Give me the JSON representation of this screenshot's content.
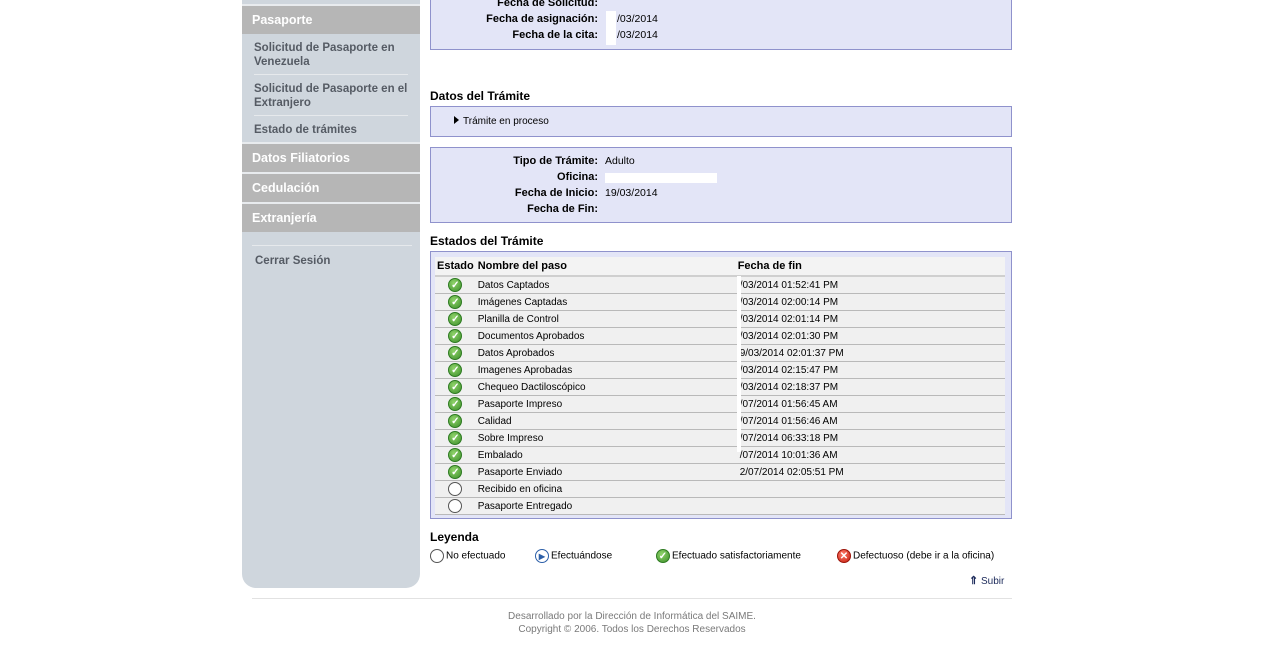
{
  "sidebar": {
    "sections": [
      "Pasaporte",
      "Datos Filiatorios",
      "Cedulación",
      "Extranjería"
    ],
    "pasaporte_items": [
      "Solicitud de Pasaporte en Venezuela",
      "Solicitud de Pasaporte en el Extranjero",
      "Estado de trámites"
    ],
    "logout": "Cerrar Sesión"
  },
  "top_box": {
    "rows": [
      {
        "label": "Fecha de Solicitud:",
        "value": ""
      },
      {
        "label": "Fecha de asignación:",
        "value": "/03/2014"
      },
      {
        "label": "Fecha de la cita:",
        "value": "/03/2014"
      }
    ]
  },
  "tramite": {
    "heading": "Datos del Trámite",
    "toggle_label": "Trámite en proceso",
    "rows": [
      {
        "label": "Tipo de Trámite:",
        "value": "Adulto"
      },
      {
        "label": "Oficina:",
        "value": ""
      },
      {
        "label": "Fecha de Inicio:",
        "value": "19/03/2014"
      },
      {
        "label": "Fecha de Fin:",
        "value": ""
      }
    ]
  },
  "estados": {
    "heading": "Estados del Trámite",
    "columns": [
      "Estado",
      "Nombre del paso",
      "Fecha de fin"
    ],
    "rows": [
      {
        "status": "ok",
        "step": "Datos Captados",
        "date": "/03/2014 01:52:41 PM"
      },
      {
        "status": "ok",
        "step": "Imágenes Captadas",
        "date": "/03/2014 02:00:14 PM"
      },
      {
        "status": "ok",
        "step": "Planilla de Control",
        "date": "/03/2014 02:01:14 PM"
      },
      {
        "status": "ok",
        "step": "Documentos Aprobados",
        "date": "/03/2014 02:01:30 PM"
      },
      {
        "status": "ok",
        "step": "Datos Aprobados",
        "date": "9/03/2014 02:01:37 PM"
      },
      {
        "status": "ok",
        "step": "Imagenes Aprobadas",
        "date": "/03/2014 02:15:47 PM"
      },
      {
        "status": "ok",
        "step": "Chequeo Dactiloscópico",
        "date": "/03/2014 02:18:37 PM"
      },
      {
        "status": "ok",
        "step": "Pasaporte Impreso",
        "date": "/07/2014 01:56:45 AM"
      },
      {
        "status": "ok",
        "step": "Calidad",
        "date": "/07/2014 01:56:46 AM"
      },
      {
        "status": "ok",
        "step": "Sobre Impreso",
        "date": "/07/2014 06:33:18 PM"
      },
      {
        "status": "ok",
        "step": "Embalado",
        "date": "/07/2014 10:01:36 AM"
      },
      {
        "status": "ok",
        "step": "Pasaporte Enviado",
        "date": "2/07/2014 02:05:51 PM"
      },
      {
        "status": "no",
        "step": "Recibido en oficina",
        "date": ""
      },
      {
        "status": "no",
        "step": "Pasaporte Entregado",
        "date": ""
      }
    ]
  },
  "legend": {
    "heading": "Leyenda",
    "items": [
      "No efectuado",
      "Efectuándose",
      "Efectuado satisfactoriamente",
      "Defectuoso (debe ir a la oficina)"
    ]
  },
  "subir": "Subir",
  "footer": {
    "line1": "Desarrollado por la Dirección de Informática del SAIME.",
    "line2": "Copyright © 2006. Todos los Derechos Reservados"
  },
  "colors": {
    "box_bg": "#e3e5f7",
    "box_border": "#8f92cc",
    "sidebar_bg": "#cfd6dd",
    "section_bg": "#b6b6b6",
    "ok_green": "#3d8f2b"
  },
  "icons": {
    "ok": "check-circle-icon",
    "no": "empty-circle-icon",
    "in_progress": "play-circle-icon",
    "defect": "x-circle-icon",
    "subir": "double-chevron-up-icon",
    "toggle": "triangle-right-icon"
  }
}
